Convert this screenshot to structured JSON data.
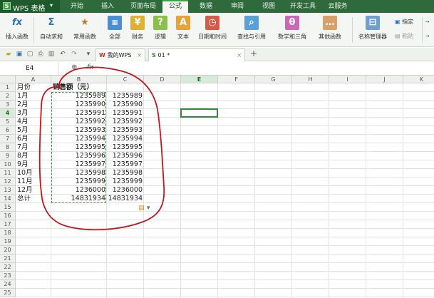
{
  "app": {
    "title": "WPS 表格",
    "logo_letter": "S",
    "caret": "▾"
  },
  "menu": {
    "tabs": [
      "开始",
      "插入",
      "页面布局",
      "公式",
      "数据",
      "审阅",
      "视图",
      "开发工具",
      "云服务"
    ],
    "active_tab": "公式"
  },
  "ribbon": {
    "insert_function": "插入函数",
    "autosum": "自动求和",
    "common_functions": "常用函数",
    "all": "全部",
    "finance": "财务",
    "logic": "逻辑",
    "text": "文本",
    "datetime": "日期和时间",
    "lookup": "查找与引用",
    "math": "数学和三角",
    "other": "其他函数",
    "name_manager": "名称管理器",
    "define": "指定",
    "paste": "粘贴",
    "dropdown_mark": "▾"
  },
  "quickbar": {
    "tab1_label": "我的WPS",
    "tab2_label": "01 *",
    "close_glyph": "×",
    "add_glyph": "+"
  },
  "formula_bar": {
    "name_box": "E4",
    "fx_label": "fx",
    "formula_value": ""
  },
  "grid": {
    "columns": [
      "A",
      "B",
      "C",
      "D",
      "E",
      "F",
      "G",
      "H",
      "I",
      "J",
      "K"
    ],
    "selected_column": "E",
    "selected_row": "4",
    "rows": [
      "1",
      "2",
      "3",
      "4",
      "5",
      "6",
      "7",
      "8",
      "9",
      "10",
      "11",
      "12",
      "13",
      "14",
      "15",
      "16",
      "17",
      "18",
      "19",
      "20",
      "21",
      "22",
      "23",
      "24",
      "25"
    ],
    "col_a": [
      "月份",
      "1月",
      "2月",
      "3月",
      "4月",
      "5月",
      "6月",
      "7月",
      "8月",
      "9月",
      "10月",
      "11月",
      "12月",
      "总计"
    ],
    "col_b": [
      "销售额（元）",
      "1235989",
      "1235990",
      "1235991",
      "1235992",
      "1235993",
      "1235994",
      "1235995",
      "1235996",
      "1235997",
      "1235998",
      "1235999",
      "1236000",
      "14831934"
    ],
    "col_c": [
      "",
      "1235989",
      "1235990",
      "1235991",
      "1235992",
      "1235993",
      "1235994",
      "1235995",
      "1235996",
      "1235997",
      "1235998",
      "1235999",
      "1236000",
      "14831934"
    ]
  },
  "colors": {
    "menubar": "#2f6a3c",
    "accent_green": "#3fa346",
    "annotation_red": "#c0161e"
  }
}
